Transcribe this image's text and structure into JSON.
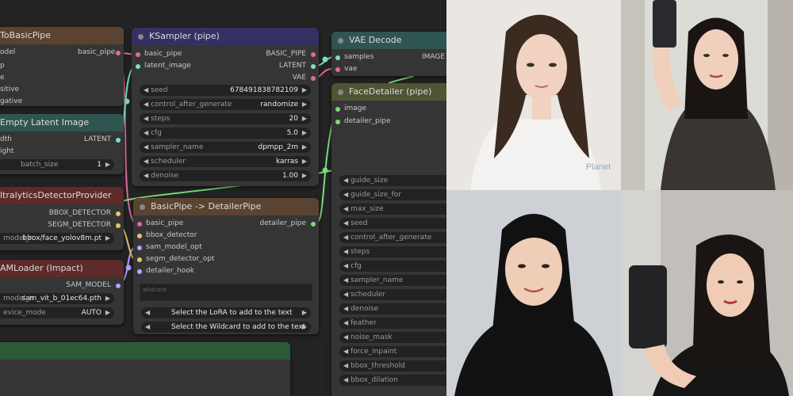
{
  "colors": {
    "pink": "#e06aa0",
    "teal": "#7de0c8",
    "purple": "#b7a0ff",
    "green": "#7cdc7a",
    "yellow": "#e8c56a",
    "lav": "#c8a0ff"
  },
  "nodes": {
    "tobasic": {
      "title": "ToBasicPipe",
      "inputs": [
        "odel",
        "p",
        "e",
        "sitive",
        "gative"
      ],
      "output": "basic_pipe"
    },
    "latent": {
      "title": "Empty Latent Image",
      "inputs": [
        "dth",
        "ight"
      ],
      "output": "LATENT",
      "widget": {
        "label": "batch_size",
        "value": "1"
      }
    },
    "ultra": {
      "title": "ltralyticsDetectorProvider",
      "outputs": [
        "BBOX_DETECTOR",
        "SEGM_DETECTOR"
      ],
      "widget": {
        "label": "model_n",
        "value": "bbox/face_yolov8m.pt"
      }
    },
    "sam": {
      "title": "AMLoader (Impact)",
      "output": "SAM_MODEL",
      "widgets": [
        {
          "label": "model_n",
          "value": "sam_vit_b_01ec64.pth"
        },
        {
          "label": "evice_mode",
          "value": "AUTO"
        }
      ]
    },
    "ksampler": {
      "title": "KSampler (pipe)",
      "inputs": [
        "basic_pipe",
        "latent_image"
      ],
      "outputs": [
        "BASIC_PIPE",
        "LATENT",
        "VAE"
      ],
      "widgets": [
        {
          "label": "seed",
          "value": "678491838782109"
        },
        {
          "label": "control_after_generate",
          "value": "randomize"
        },
        {
          "label": "steps",
          "value": "20"
        },
        {
          "label": "cfg",
          "value": "5.0"
        },
        {
          "label": "sampler_name",
          "value": "dpmpp_2m"
        },
        {
          "label": "scheduler",
          "value": "karras"
        },
        {
          "label": "denoise",
          "value": "1.00"
        }
      ]
    },
    "detailerpipe": {
      "title": "BasicPipe -> DetailerPipe",
      "inputs": [
        "basic_pipe",
        "bbox_detector",
        "sam_model_opt",
        "segm_detector_opt",
        "detailer_hook"
      ],
      "output": "detailer_pipe",
      "wildcard_placeholder": "wildcard",
      "selects": [
        "Select the LoRA to add to the text",
        "Select the Wildcard to add to the text"
      ]
    },
    "vae": {
      "title": "VAE Decode",
      "inputs": [
        "samples",
        "vae"
      ],
      "output": "IMAGE"
    },
    "face": {
      "title": "FaceDetailer (pipe)",
      "inputs": [
        "image",
        "detailer_pipe"
      ],
      "widgets": [
        "guide_size",
        "guide_size_for",
        "max_size",
        "seed",
        "control_after_generate",
        "steps",
        "cfg",
        "sampler_name",
        "scheduler",
        "denoise",
        "feather",
        "noise_mask",
        "force_inpaint",
        "bbox_threshold",
        "bbox_dilation"
      ]
    }
  },
  "photos": {
    "watermark": "Planet"
  }
}
